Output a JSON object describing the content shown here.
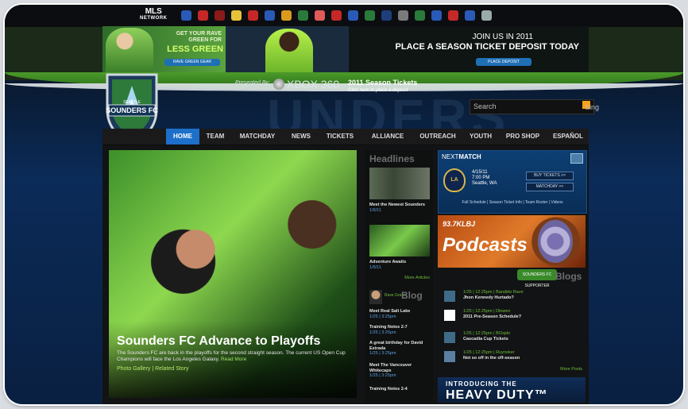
{
  "top_bar": {
    "network_label": "MLS",
    "network_sublabel": "NETWORK",
    "club_crest_colors": [
      "#2a5ab8",
      "#c62828",
      "#8b1a1a",
      "#e6c23a",
      "#c62828",
      "#2a5ab8",
      "#d99a1f",
      "#2a7a3c",
      "#e05a5a",
      "#c62828",
      "#2a5ab8",
      "#2a7a3c",
      "#1f3f7a",
      "#7a7a7a",
      "#2a7a3c",
      "#2a5ab8",
      "#c62828",
      "#2a5ab8",
      "#9aa"
    ]
  },
  "banner": {
    "left_line1": "GET YOUR RAVE",
    "left_line2": "GREEN FOR",
    "left_highlight": "LESS GREEN",
    "left_button": "RAVE GREEN GEAR",
    "right_line1": "JOIN US IN 2011",
    "right_line2": "PLACE A SEASON TICKET DEPOSIT TODAY",
    "right_button": "PLACE DEPOSIT"
  },
  "header": {
    "logo_name": "SOUNDERS FC",
    "logo_city": "SEATTLE",
    "presented_by": "Presented By:",
    "sponsor": "XBOX 360",
    "season_title": "2011 Season Tickets",
    "season_sub": "Click here to place a deposit",
    "search_placeholder": "Search",
    "search_brand": "bing",
    "bg_watermark": "UNDERS"
  },
  "nav": [
    {
      "label": "HOME",
      "active": true
    },
    {
      "label": "TEAM"
    },
    {
      "label": "MATCHDAY"
    },
    {
      "label": "NEWS"
    },
    {
      "label": "TICKETS"
    },
    {
      "label": "ALLIANCE"
    },
    {
      "label": "OUTREACH"
    },
    {
      "label": "YOUTH"
    },
    {
      "label": "PRO SHOP"
    },
    {
      "label": "ESPAÑOL"
    }
  ],
  "hero": {
    "title": "Sounders FC Advance to Playoffs",
    "description": "The Sounders FC are back in the playoffs for the second straight season. The current US Open Cup Champions will face the Los Angeles Galaxy.",
    "read_more": "Read More",
    "links": "Photo Gallery | Related Story"
  },
  "headlines": {
    "title": "Headlines",
    "items": [
      {
        "title": "Meet the Newest Sounders",
        "date": "1/6/11"
      },
      {
        "title": "Adventure Awaits",
        "date": "1/6/11"
      }
    ],
    "more": "More Articles"
  },
  "blog": {
    "prefix": "Rave Green",
    "title": "Blog",
    "items": [
      {
        "title": "Meet Real Salt Lake",
        "date": "1/25 | 3:25pm"
      },
      {
        "title": "Training Notes 2-7",
        "date": "1/25 | 3:25pm"
      },
      {
        "title": "A great birthday for David Estrada",
        "date": "1/25 | 3:25pm"
      },
      {
        "title": "Meet The Vancouver Whitecaps",
        "date": "1/25 | 3:25pm"
      },
      {
        "title": "Training Notes 2-4",
        "date": ""
      }
    ]
  },
  "next_match": {
    "label_a": "NEXT",
    "label_b": "MATCH",
    "opponent": "LA",
    "date": "4/15/11",
    "time": "7:00 PM",
    "place": "Seattle, WA",
    "btn_tickets": "BUY TICKETS >>",
    "btn_matchday": "MATCHDAY >>",
    "footer": "Full Schedule | Season Ticket Info | Team Roster | Videos"
  },
  "podcast": {
    "station": "93.7KLBJ",
    "title": "Podcasts"
  },
  "sounders_blogs": {
    "badge": "SOUNDERS FC SUPPORTER",
    "title": "Blogs",
    "items": [
      {
        "meta": "1/25 | 12:25pm | Bandido Rave",
        "title": "Jhon Kennedy Hurtado?"
      },
      {
        "meta": "1/25 | 12:25pm | Dlowen",
        "title": "2011 Pre-Season Schedule?"
      },
      {
        "meta": "1/25 | 12:25pm | BOsplo",
        "title": "Cascadia Cup Tickets"
      },
      {
        "meta": "1/25 | 12:25pm | Ruynoker",
        "title": "Not so off in the off-season"
      }
    ],
    "more": "More Posts"
  },
  "promo": {
    "line1": "INTRODUCING THE",
    "line2": "HEAVY DUTY™"
  }
}
